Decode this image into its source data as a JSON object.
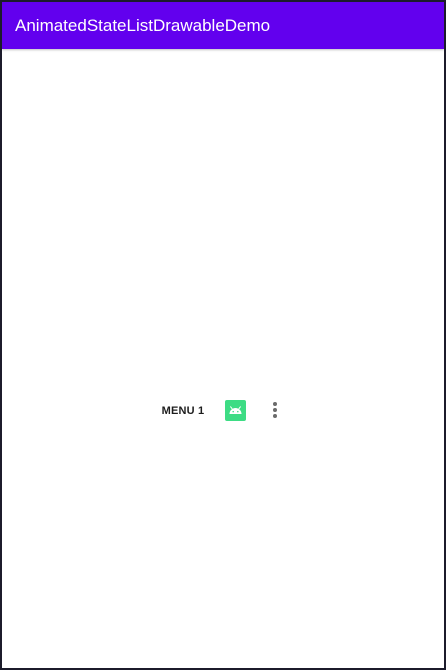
{
  "app_bar": {
    "title": "AnimatedStateListDrawableDemo",
    "background_color": "#6200ee"
  },
  "toolbar": {
    "menu_item_label": "MENU 1",
    "action_icon": "android-icon",
    "action_icon_color": "#3ddc84",
    "overflow_icon": "more-vert-icon"
  }
}
